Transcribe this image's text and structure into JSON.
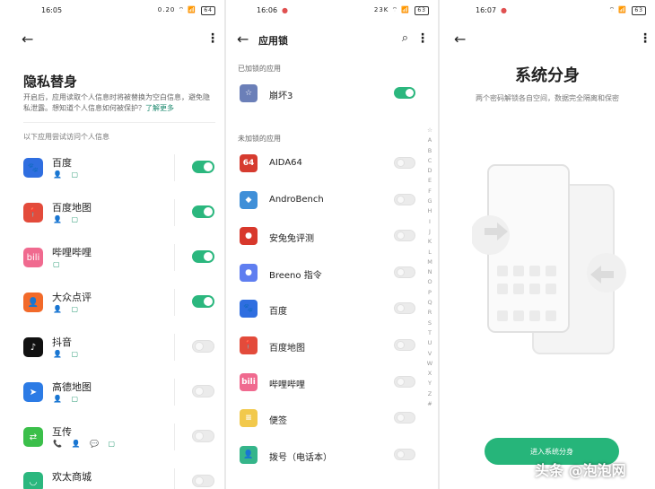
{
  "privacy": {
    "status": {
      "time": "16:05",
      "icons": "0.20 ⌔ 📶 ",
      "battery": "64"
    },
    "title": "隐私替身",
    "description": "开启后，应用读取个人信息时将被替换为空白信息，避免隐私泄露。想知道个人信息如何被保护？",
    "learn_more": "了解更多",
    "section_label": "以下应用尝试访问个人信息",
    "apps": [
      {
        "name": "百度",
        "perms": "👤 ▢",
        "on": true,
        "color": "#2f6ee0",
        "glyph": "🐾"
      },
      {
        "name": "百度地图",
        "perms": "👤 ▢",
        "on": true,
        "color": "#e34b3b",
        "glyph": "📍"
      },
      {
        "name": "哔哩哔哩",
        "perms": "▢",
        "on": true,
        "color": "#f06a8f",
        "glyph": "bili"
      },
      {
        "name": "大众点评",
        "perms": "👤 ▢",
        "on": true,
        "color": "#f26a2a",
        "glyph": "👤"
      },
      {
        "name": "抖音",
        "perms": "👤 ▢",
        "on": false,
        "color": "#111111",
        "glyph": "♪"
      },
      {
        "name": "高德地图",
        "perms": "👤 ▢",
        "on": false,
        "color": "#2c7be5",
        "glyph": "➤"
      },
      {
        "name": "互传",
        "perms": "📞 👤 💬 ▢",
        "on": false,
        "color": "#3bbf4a",
        "glyph": "⇄"
      },
      {
        "name": "欢太商城",
        "perms": "",
        "on": false,
        "color": "#2bb77e",
        "glyph": "◡"
      }
    ]
  },
  "applock": {
    "status": {
      "time": "16:06",
      "icons": "23K ⌔ 📶 ",
      "battery": "63"
    },
    "title": "应用锁",
    "locked_label": "已加锁的应用",
    "unlocked_label": "未加锁的应用",
    "locked": [
      {
        "name": "崩坏3",
        "on": true,
        "color": "#6b7fb8",
        "glyph": "☆"
      }
    ],
    "unlocked": [
      {
        "name": "AIDA64",
        "color": "#d63b2f",
        "glyph": "64"
      },
      {
        "name": "AndroBench",
        "color": "#3f8fd8",
        "glyph": "◆"
      },
      {
        "name": "安兔兔评测",
        "color": "#d8382c",
        "glyph": "●"
      },
      {
        "name": "Breeno 指令",
        "color": "#5f7ef0",
        "glyph": "●"
      },
      {
        "name": "百度",
        "color": "#2f6ee0",
        "glyph": "🐾"
      },
      {
        "name": "百度地图",
        "color": "#e34b3b",
        "glyph": "📍"
      },
      {
        "name": "哔哩哔哩",
        "color": "#f06a8f",
        "glyph": "bili"
      },
      {
        "name": "便签",
        "color": "#f2c94c",
        "glyph": "≡"
      },
      {
        "name": "拨号（电话本）",
        "color": "#35b58a",
        "glyph": "👤"
      }
    ],
    "alphabet": [
      "☆",
      "A",
      "B",
      "C",
      "D",
      "E",
      "F",
      "G",
      "H",
      "I",
      "J",
      "K",
      "L",
      "M",
      "N",
      "O",
      "P",
      "Q",
      "R",
      "S",
      "T",
      "U",
      "V",
      "W",
      "X",
      "Y",
      "Z",
      "#"
    ]
  },
  "clone": {
    "status": {
      "time": "16:07",
      "icons": "⌔ 📶 ",
      "battery": "63"
    },
    "title": "系统分身",
    "subtitle": "两个密码解锁各自空间，数据完全隔离和保密",
    "button": "进入系统分身",
    "watermark": "头条 @泡泡网"
  }
}
